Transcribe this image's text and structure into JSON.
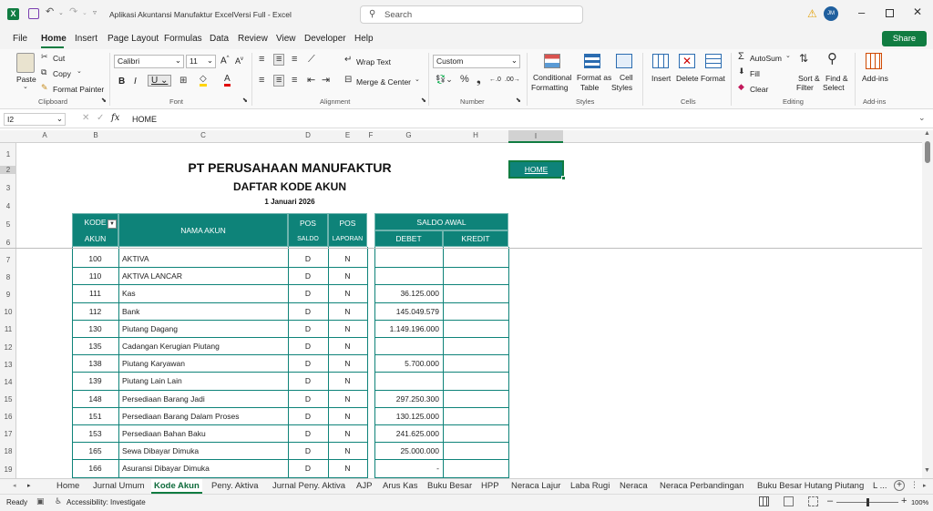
{
  "titlebar": {
    "doc_title": "Aplikasi Akuntansi Manufaktur ExcelVersi Full  -  Excel",
    "search_placeholder": "Search",
    "avatar_initials": "JM"
  },
  "menu": [
    "File",
    "Home",
    "Insert",
    "Page Layout",
    "Formulas",
    "Data",
    "Review",
    "View",
    "Developer",
    "Help"
  ],
  "share_label": "Share",
  "ribbon": {
    "paste": "Paste",
    "cut": "Cut",
    "copy": "Copy",
    "format_painter": "Format Painter",
    "clipboard": "Clipboard",
    "font_name": "Calibri",
    "font_size": "11",
    "font": "Font",
    "wrap_text": "Wrap Text",
    "merge_center": "Merge & Center",
    "alignment": "Alignment",
    "number_format": "Custom",
    "number": "Number",
    "cond_fmt_1": "Conditional",
    "cond_fmt_2": "Formatting",
    "fmt_table_1": "Format as",
    "fmt_table_2": "Table",
    "cell_styles_1": "Cell",
    "cell_styles_2": "Styles",
    "styles": "Styles",
    "insert": "Insert",
    "delete": "Delete",
    "format": "Format",
    "cells": "Cells",
    "autosum": "AutoSum",
    "fill": "Fill",
    "clear": "Clear",
    "sort_1": "Sort &",
    "sort_2": "Filter",
    "find_1": "Find &",
    "find_2": "Select",
    "editing": "Editing",
    "addins": "Add-ins",
    "addins_group": "Add-ins"
  },
  "formula_bar": {
    "name_box": "I2",
    "formula": "HOME"
  },
  "columns": [
    "A",
    "B",
    "C",
    "D",
    "E",
    "F",
    "G",
    "H",
    "I"
  ],
  "rows": [
    "1",
    "2",
    "3",
    "4",
    "5",
    "6",
    "7",
    "8",
    "9",
    "10",
    "11",
    "12",
    "13",
    "14",
    "15",
    "16",
    "17",
    "18",
    "19",
    "20"
  ],
  "sheet": {
    "company": "PT PERUSAHAAN MANUFAKTUR",
    "title": "DAFTAR KODE AKUN",
    "date": "1 Januari 2026",
    "home_link": "HOME",
    "hdr_kode_1": "KODE",
    "hdr_kode_2": "AKUN",
    "hdr_nama": "NAMA AKUN",
    "hdr_pos": "POS",
    "hdr_saldo": "SALDO",
    "hdr_laporan": "LAPORAN",
    "hdr_saldo_awal": "SALDO AWAL",
    "hdr_debet": "DEBET",
    "hdr_kredit": "KREDIT"
  },
  "accounts": [
    {
      "kode": "100",
      "nama": "AKTIVA",
      "pos_saldo": "D",
      "pos_laporan": "N",
      "debet": "",
      "kredit": ""
    },
    {
      "kode": "110",
      "nama": "AKTIVA LANCAR",
      "pos_saldo": "D",
      "pos_laporan": "N",
      "debet": "",
      "kredit": ""
    },
    {
      "kode": "111",
      "nama": "Kas",
      "pos_saldo": "D",
      "pos_laporan": "N",
      "debet": "36.125.000",
      "kredit": ""
    },
    {
      "kode": "112",
      "nama": "Bank",
      "pos_saldo": "D",
      "pos_laporan": "N",
      "debet": "145.049.579",
      "kredit": ""
    },
    {
      "kode": "130",
      "nama": "Piutang Dagang",
      "pos_saldo": "D",
      "pos_laporan": "N",
      "debet": "1.149.196.000",
      "kredit": ""
    },
    {
      "kode": "135",
      "nama": "Cadangan Kerugian Piutang",
      "pos_saldo": "D",
      "pos_laporan": "N",
      "debet": "",
      "kredit": ""
    },
    {
      "kode": "138",
      "nama": "Piutang Karyawan",
      "pos_saldo": "D",
      "pos_laporan": "N",
      "debet": "5.700.000",
      "kredit": ""
    },
    {
      "kode": "139",
      "nama": "Piutang Lain Lain",
      "pos_saldo": "D",
      "pos_laporan": "N",
      "debet": "",
      "kredit": ""
    },
    {
      "kode": "148",
      "nama": "Persediaan Barang Jadi",
      "pos_saldo": "D",
      "pos_laporan": "N",
      "debet": "297.250.300",
      "kredit": ""
    },
    {
      "kode": "151",
      "nama": "Persediaan Barang Dalam Proses",
      "pos_saldo": "D",
      "pos_laporan": "N",
      "debet": "130.125.000",
      "kredit": ""
    },
    {
      "kode": "153",
      "nama": "Persediaan Bahan Baku",
      "pos_saldo": "D",
      "pos_laporan": "N",
      "debet": "241.625.000",
      "kredit": ""
    },
    {
      "kode": "165",
      "nama": "Sewa Dibayar Dimuka",
      "pos_saldo": "D",
      "pos_laporan": "N",
      "debet": "25.000.000",
      "kredit": ""
    },
    {
      "kode": "166",
      "nama": "Asuransi Dibayar Dimuka",
      "pos_saldo": "D",
      "pos_laporan": "N",
      "debet": "-",
      "kredit": ""
    }
  ],
  "tabs": [
    "Home",
    "Jurnal Umum",
    "Kode Akun",
    "Peny. Aktiva",
    "Jurnal Peny. Aktiva",
    "AJP",
    "Arus Kas",
    "Buku Besar",
    "HPP",
    "Neraca Lajur",
    "Laba Rugi",
    "Neraca",
    "Neraca Perbandingan",
    "Buku Besar Hutang Piutang",
    "L ..."
  ],
  "active_tab": "Kode Akun",
  "status": {
    "ready": "Ready",
    "accessibility": "Accessibility: Investigate",
    "zoom": "100%"
  },
  "colors": {
    "accent": "#0e8379",
    "excel_green": "#107c41"
  }
}
